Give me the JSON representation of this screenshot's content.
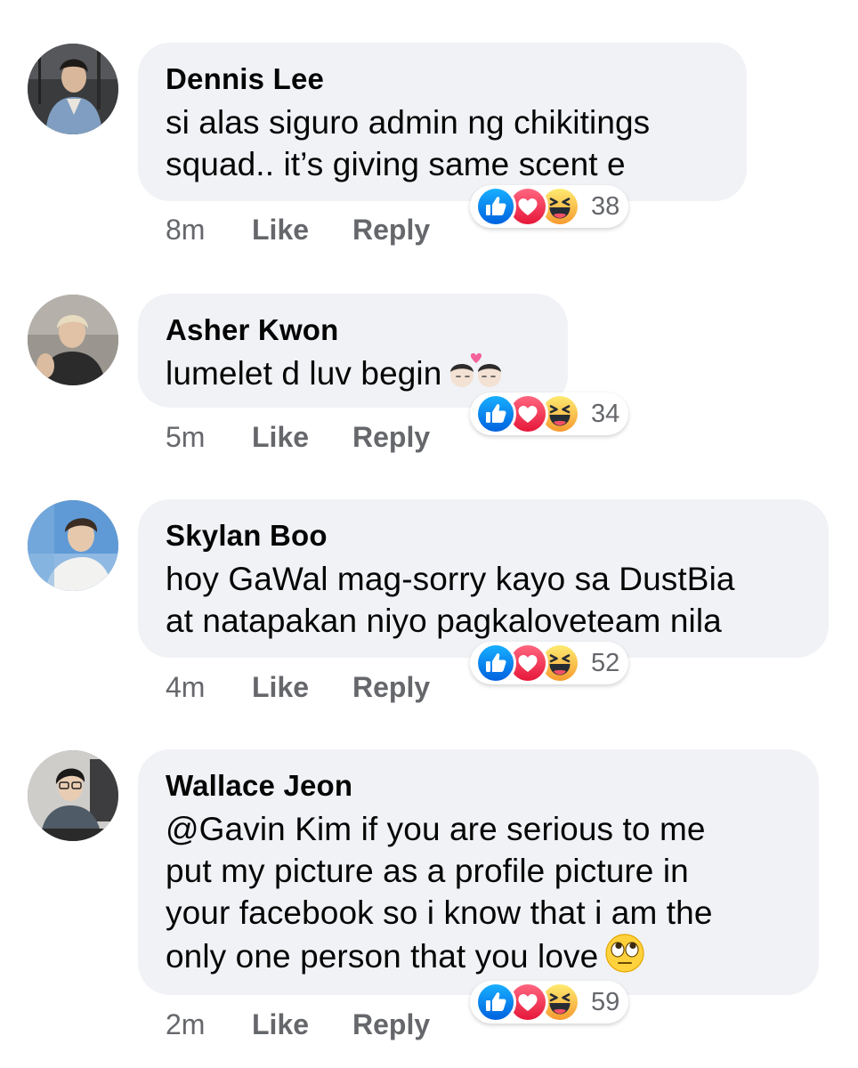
{
  "comments": [
    {
      "author": "Dennis Lee",
      "lines": [
        "si alas siguro admin ng chikitings",
        "squad.. it’s giving same scent e"
      ],
      "time": "8m",
      "like_label": "Like",
      "reply_label": "Reply",
      "reaction_count": "38",
      "reactions": [
        "like-icon",
        "love-icon",
        "haha-icon"
      ]
    },
    {
      "author": "Asher Kwon",
      "lines": [
        "lumelet d luv begin"
      ],
      "emoji": "kiss-couple-emoji",
      "time": "5m",
      "like_label": "Like",
      "reply_label": "Reply",
      "reaction_count": "34",
      "reactions": [
        "like-icon",
        "love-icon",
        "haha-icon"
      ]
    },
    {
      "author": "Skylan Boo",
      "lines": [
        "hoy GaWal mag-sorry kayo sa DustBia",
        "at natapakan niyo pagkaloveteam nila"
      ],
      "time": "4m",
      "like_label": "Like",
      "reply_label": "Reply",
      "reaction_count": "52",
      "reactions": [
        "like-icon",
        "love-icon",
        "haha-icon"
      ]
    },
    {
      "author": "Wallace Jeon",
      "lines": [
        "@Gavin Kim if you are serious to me",
        "put my picture as a profile picture in",
        "your facebook so i know that i am the",
        "only one person that you love"
      ],
      "emoji": "eye-roll-emoji",
      "time": "2m",
      "like_label": "Like",
      "reply_label": "Reply",
      "reaction_count": "59",
      "reactions": [
        "like-icon",
        "love-icon",
        "haha-icon"
      ]
    }
  ],
  "colors": {
    "bubble": "#f0f2f5",
    "meta_text": "#65676b",
    "like_blue": "#1877f2",
    "love_red": "#f33e58",
    "haha_yellow": "#f7b125"
  }
}
